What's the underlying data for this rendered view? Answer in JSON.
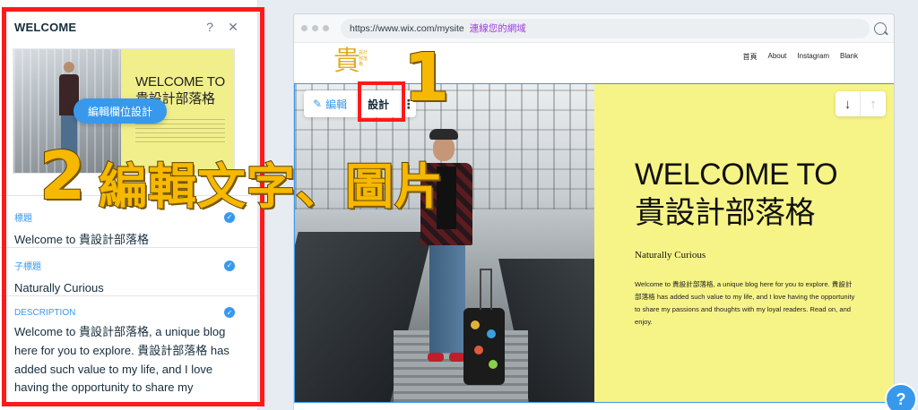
{
  "panel": {
    "title": "WELCOME",
    "help_icon": "?",
    "close_icon": "✕",
    "thumbnail_heading": "WELCOME TO 貴設計部落格",
    "edit_design_button": "編輯欄位設計",
    "fields": [
      {
        "label": "標題",
        "value": "Welcome to 貴設計部落格"
      },
      {
        "label": "子標題",
        "value": "Naturally Curious"
      },
      {
        "label": "DESCRIPTION",
        "value": "Welcome to 貴設計部落格, a unique blog here for you to explore. 貴設計部落格 has added such value to my life, and I love having the opportunity to share my"
      }
    ]
  },
  "browser": {
    "url": "https://www.wix.com/mysite",
    "connect_domain": "連線您的網域",
    "logo_main": "貴",
    "logo_side": "設計部落格",
    "nav": [
      "首頁",
      "About",
      "Instagram",
      "Blank"
    ]
  },
  "toolbar": {
    "edit_label": "編輯",
    "design_label": "設計",
    "more_label": "⋮"
  },
  "hero": {
    "heading": "WELCOME TO 貴設計部落格",
    "subheading": "Naturally Curious",
    "body": "Welcome to 貴設計部落格, a unique blog here for you to explore. 貴設計部落格 has added such value to my life, and I love having the opportunity to share my passions and thoughts with my loyal readers. Read on, and enjoy.",
    "arrow_down": "↓",
    "arrow_up": "↑"
  },
  "help": "?",
  "annotations": {
    "step1": "1",
    "step2_number": "2",
    "step2_text": "編輯文字、圖片"
  },
  "colors": {
    "accent": "#3899ec",
    "highlight_red": "#ff1a1a",
    "hero_yellow": "#f7f487",
    "callout_yellow": "#f6b800"
  }
}
